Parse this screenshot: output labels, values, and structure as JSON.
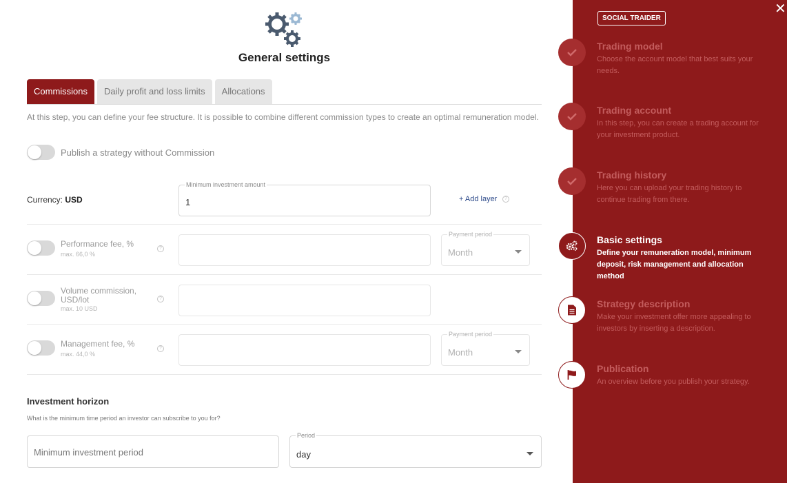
{
  "main": {
    "title": "General settings",
    "tabs": [
      {
        "label": "Commissions",
        "active": true
      },
      {
        "label": "Daily profit and loss limits",
        "active": false
      },
      {
        "label": "Allocations",
        "active": false
      }
    ],
    "intro": "At this step, you can define your fee structure. It is possible to combine different commission types to create an optimal remuneration model.",
    "publish_toggle_label": "Publish a strategy without Commission",
    "currency_label": "Currency:",
    "currency_value": "USD",
    "min_investment": {
      "label": "Minimum investment amount",
      "value": "1"
    },
    "add_layer": "+ Add layer",
    "help_glyph": "?",
    "fees": [
      {
        "label": "Performance fee, %",
        "sub": "max. 66,0 %",
        "period_label": "Payment period",
        "period_value": "Month"
      },
      {
        "label": "Volume commission, USD/lot",
        "sub": "max. 10 USD"
      },
      {
        "label": "Management fee, %",
        "sub": "max. 44,0 %",
        "period_label": "Payment period",
        "period_value": "Month"
      }
    ],
    "horizon": {
      "title": "Investment horizon",
      "subtitle": "What is the minimum time period an investor can subscribe to you for?",
      "min_period_placeholder": "Minimum investment period",
      "period_label": "Period",
      "period_value": "day"
    }
  },
  "sidebar": {
    "badge": "SOCIAL TRAIDER",
    "close_glyph": "✕",
    "steps": [
      {
        "title": "Trading model",
        "desc": "Choose the account model that best suits your needs.",
        "state": "done",
        "icon": "check-icon"
      },
      {
        "title": "Trading account",
        "desc": "In this step, you can create a trading account for your investment product.",
        "state": "done",
        "icon": "check-icon"
      },
      {
        "title": "Trading history",
        "desc": "Here you can upload your trading history to continue trading from there.",
        "state": "done",
        "icon": "check-icon"
      },
      {
        "title": "Basic settings",
        "desc": "Define your remuneration model, minimum deposit, risk management and allocation method",
        "state": "active",
        "icon": "gears-icon"
      },
      {
        "title": "Strategy description",
        "desc": "Make your investment offer more appealing to investors by inserting a description.",
        "state": "todo",
        "icon": "document-icon"
      },
      {
        "title": "Publication",
        "desc": "An overview before you publish your strategy.",
        "state": "todo",
        "icon": "flag-icon"
      }
    ]
  },
  "colors": {
    "brand": "#8e1a1b",
    "tab_inactive": "#e6e6e6",
    "muted_text": "#8a8a8a"
  }
}
